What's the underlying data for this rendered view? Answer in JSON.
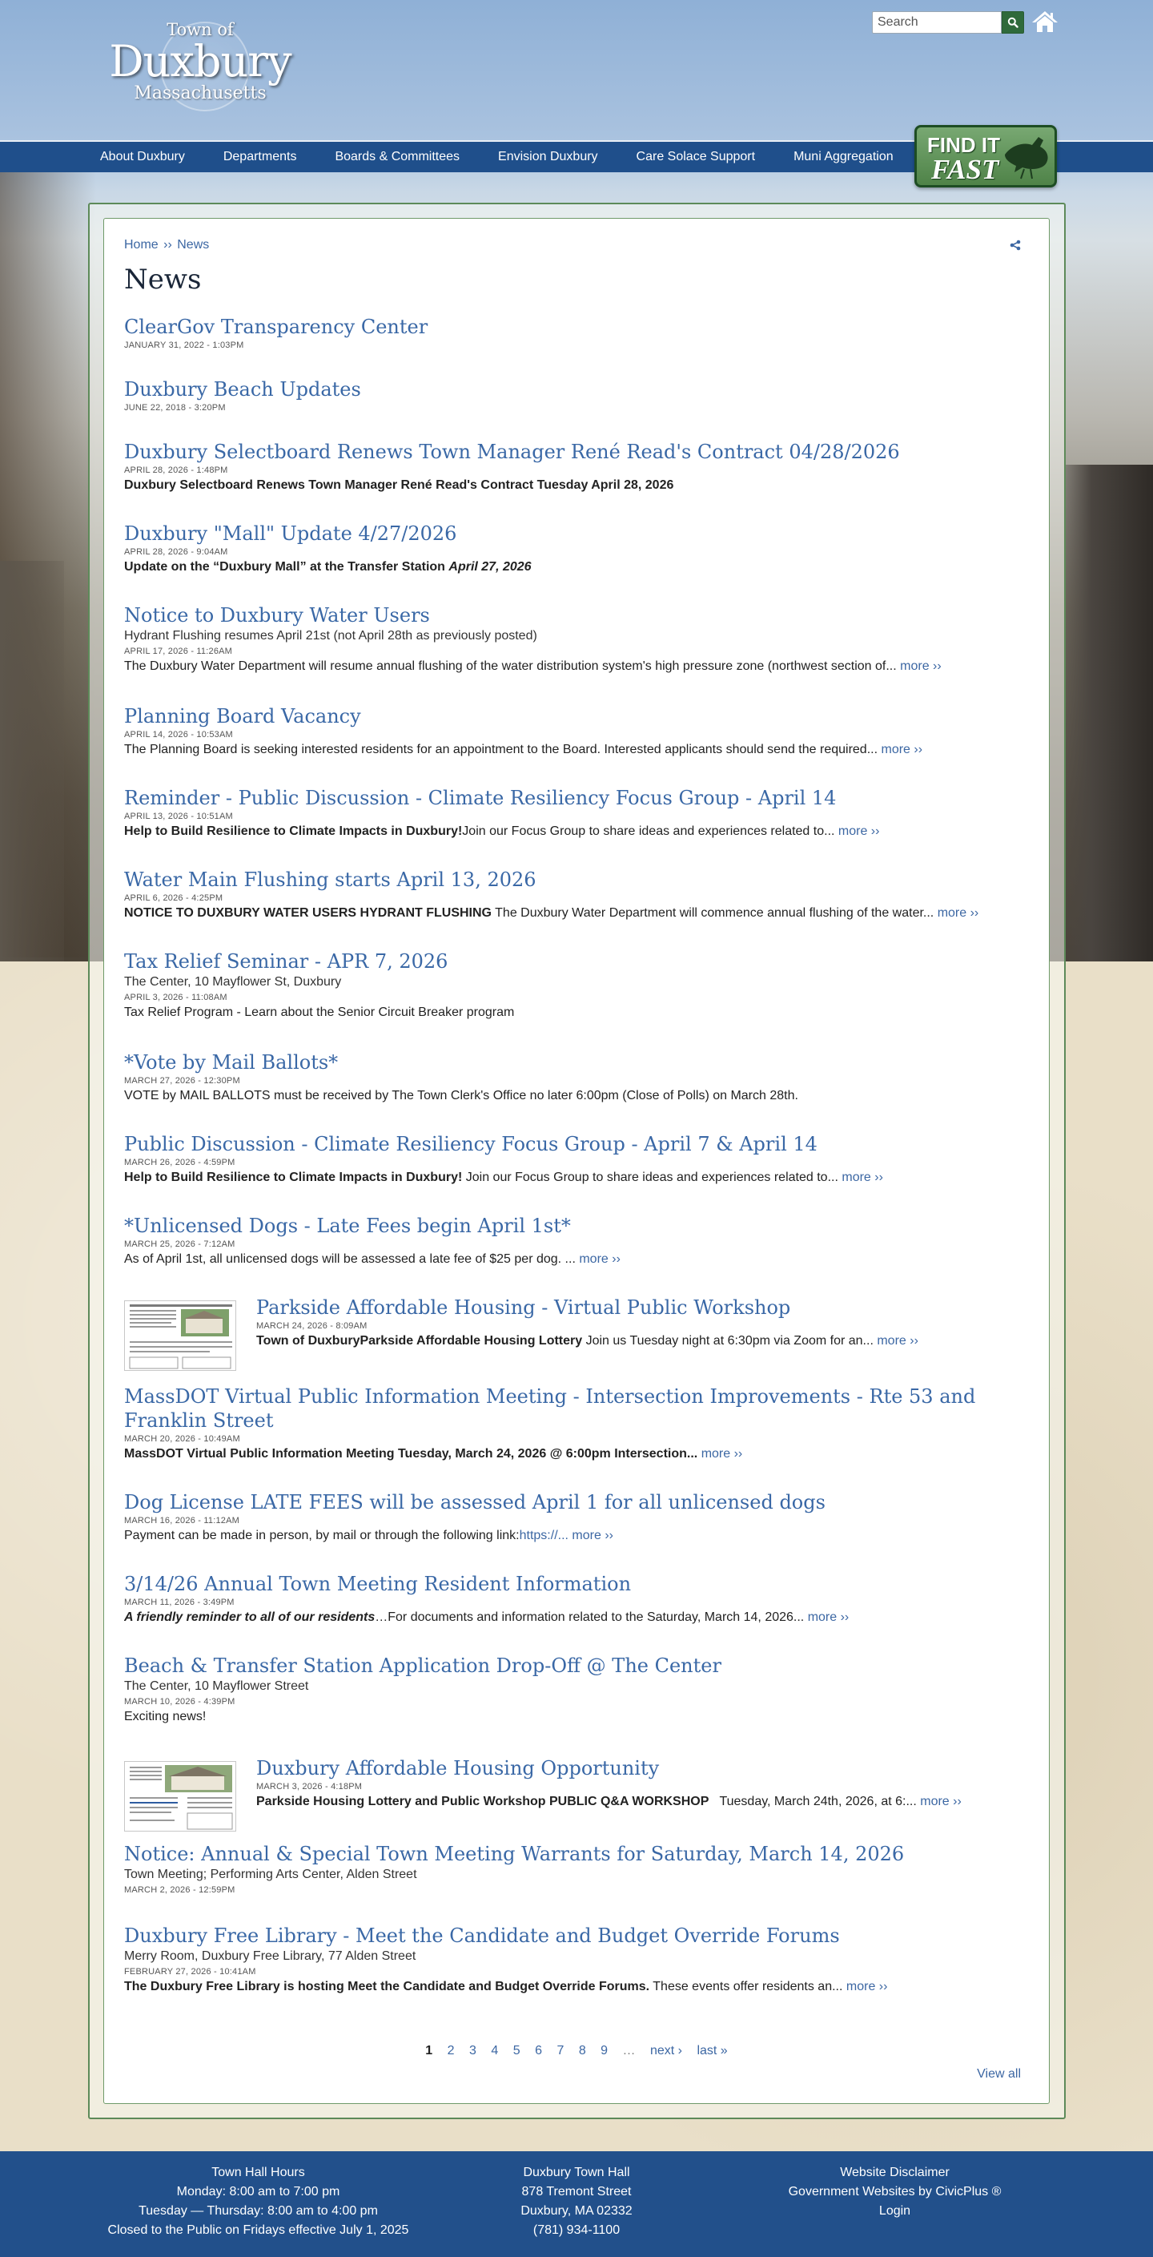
{
  "header": {
    "logo": {
      "line1": "Town of",
      "line2": "Duxbury",
      "line3": "Massachusetts"
    },
    "search": {
      "placeholder": "Search",
      "icon": "search-icon"
    },
    "home_icon": "home-icon"
  },
  "nav": {
    "items": [
      {
        "label": "About Duxbury"
      },
      {
        "label": "Departments"
      },
      {
        "label": "Boards & Committees"
      },
      {
        "label": "Envision Duxbury"
      },
      {
        "label": "Care Solace Support"
      },
      {
        "label": "Muni Aggregation"
      }
    ],
    "find_it_fast": {
      "line1": "FIND IT",
      "line2": "FAST"
    }
  },
  "breadcrumb": {
    "home": "Home",
    "separator": "››",
    "current": "News"
  },
  "page_title": "News",
  "news": [
    {
      "title": "ClearGov Transparency Center",
      "date": "JANUARY 31, 2022 - 1:03PM"
    },
    {
      "title": "Duxbury Beach Updates",
      "date": "JUNE 22, 2018 - 3:20PM"
    },
    {
      "title": "Duxbury Selectboard Renews Town Manager René Read's Contract 04/28/2026",
      "date": "APRIL 28, 2026 - 1:48PM",
      "summary_bold": "Duxbury Selectboard Renews Town Manager René Read's Contract Tuesday April 28, 2026"
    },
    {
      "title": "Duxbury \"Mall\" Update 4/27/2026",
      "date": "APRIL 28, 2026 - 9:04AM",
      "summary_bold": "Update on the “Duxbury Mall” at the Transfer Station ",
      "summary_italic": "April 27, 2026"
    },
    {
      "title": "Notice to Duxbury Water Users",
      "location": "Hydrant Flushing resumes April 21st (not April 28th as previously posted)",
      "date": "APRIL 17, 2026 - 11:26AM",
      "summary": "The Duxbury Water Department will resume annual flushing of the water distribution system's high pressure zone (northwest section of...",
      "more": "more ››"
    },
    {
      "title": "Planning Board Vacancy",
      "date": "APRIL 14, 2026 - 10:53AM",
      "summary": "The Planning Board is seeking interested residents for an appointment to the Board. Interested applicants should send the required...",
      "more": "more ››"
    },
    {
      "title": "Reminder - Public Discussion - Climate Resiliency Focus Group - April 14",
      "date": "APRIL 13, 2026 - 10:51AM",
      "summary_bold": "Help to Build Resilience to Climate Impacts in Duxbury!",
      "summary": "Join our Focus Group to share ideas and experiences related to...",
      "more": "more ››"
    },
    {
      "title": "Water Main Flushing starts April 13, 2026",
      "date": "APRIL 6, 2026 - 4:25PM",
      "summary_bold": "NOTICE TO DUXBURY WATER USERS HYDRANT FLUSHING",
      "summary": " The Duxbury Water Department will commence annual flushing of the water...",
      "more": "more ››"
    },
    {
      "title": "Tax Relief Seminar - APR 7, 2026",
      "location": "The Center, 10 Mayflower St, Duxbury",
      "date": "APRIL 3, 2026 - 11:08AM",
      "summary": "Tax Relief Program - Learn about the Senior Circuit Breaker program"
    },
    {
      "title": "*Vote by Mail Ballots*",
      "date": "MARCH 27, 2026 - 12:30PM",
      "summary": "VOTE by MAIL BALLOTS must be received by The Town Clerk's Office no later 6:00pm (Close of Polls) on March 28th."
    },
    {
      "title": "Public Discussion - Climate Resiliency Focus Group - April 7 & April 14",
      "date": "MARCH 26, 2026 - 4:59PM",
      "summary_bold": "Help to Build Resilience to Climate Impacts in Duxbury!",
      "summary": " Join our Focus Group to share ideas and experiences related to...",
      "more": "more ››"
    },
    {
      "title": "*Unlicensed Dogs - Late Fees begin April 1st*",
      "date": "MARCH 25, 2026 - 7:12AM",
      "summary": "As of April 1st, all unlicensed dogs will be assessed a late fee of $25 per dog. ...",
      "more": "more ››"
    },
    {
      "title": "Parkside Affordable Housing - Virtual Public Workshop",
      "date": "MARCH 24, 2026 - 8:09AM",
      "thumbnail": true,
      "summary_bold": "Town of DuxburyParkside Affordable Housing Lottery",
      "summary": " Join us Tuesday night at 6:30pm via Zoom for an...",
      "more": "more ››"
    },
    {
      "title": "MassDOT Virtual Public Information Meeting - Intersection Improvements - Rte 53 and Franklin Street",
      "date": "MARCH 20, 2026 - 10:49AM",
      "summary_bold": "MassDOT Virtual Public Information Meeting Tuesday, March 24, 2026 @ 6:00pm  Intersection...",
      "more": "more ››"
    },
    {
      "title": "Dog License LATE FEES will be assessed April 1 for all unlicensed dogs",
      "date": "MARCH 16, 2026 - 11:12AM",
      "summary": "Payment can be made in person, by mail or through the following link:",
      "summary_link": "https://...",
      "more": "more ››"
    },
    {
      "title": "3/14/26 Annual Town Meeting Resident Information",
      "date": "MARCH 11, 2026 - 3:49PM",
      "summary_italic": "A friendly reminder to all of our residents",
      "summary": "…For documents and information related to the Saturday, March 14, 2026...",
      "more": "more ››"
    },
    {
      "title": "Beach & Transfer Station Application Drop-Off @ The Center",
      "location": "The Center, 10 Mayflower Street",
      "date": "MARCH 10, 2026 - 4:39PM",
      "summary": "Exciting news!"
    },
    {
      "title": "Duxbury Affordable Housing Opportunity",
      "date": "MARCH 3, 2026 - 4:18PM",
      "thumbnail": true,
      "summary_bold": "Parkside Housing Lottery and Public Workshop  PUBLIC Q&A WORKSHOP",
      "summary": "   Tuesday, March 24th, 2026, at 6:...",
      "more": "more ››"
    },
    {
      "title": "Notice: Annual & Special Town Meeting Warrants for Saturday, March 14, 2026",
      "location": "Town Meeting; Performing Arts Center, Alden Street",
      "date": "MARCH 2, 2026 - 12:59PM"
    },
    {
      "title": "Duxbury Free Library - Meet the Candidate and Budget Override Forums",
      "location": "Merry Room, Duxbury Free Library, 77 Alden Street",
      "date": "FEBRUARY 27, 2026 - 10:41AM",
      "summary_bold": "The Duxbury Free Library is hosting Meet the Candidate and Budget Override Forums.",
      "summary": " These events offer residents an...",
      "more": "more ››"
    }
  ],
  "pager": {
    "pages": [
      "1",
      "2",
      "3",
      "4",
      "5",
      "6",
      "7",
      "8",
      "9"
    ],
    "current": "1",
    "ellipsis": "…",
    "next": "next ›",
    "last": "last »"
  },
  "view_all": "View all",
  "footer": {
    "hours": [
      "Town Hall Hours",
      "Monday:  8:00 am to 7:00 pm",
      "Tuesday — Thursday:  8:00 am to 4:00 pm",
      "Closed to the Public on Fridays effective July 1, 2025"
    ],
    "address": [
      "Duxbury Town Hall",
      "878 Tremont Street",
      "Duxbury, MA 02332",
      "(781) 934-1100"
    ],
    "links": [
      "Website Disclaimer",
      "Government Websites by CivicPlus ®",
      "Login"
    ]
  },
  "colors": {
    "nav_bg": "#1f4f8b",
    "link": "#3a68a6",
    "accent_green": "#2f6a3b",
    "footer_bg": "#22508b"
  }
}
